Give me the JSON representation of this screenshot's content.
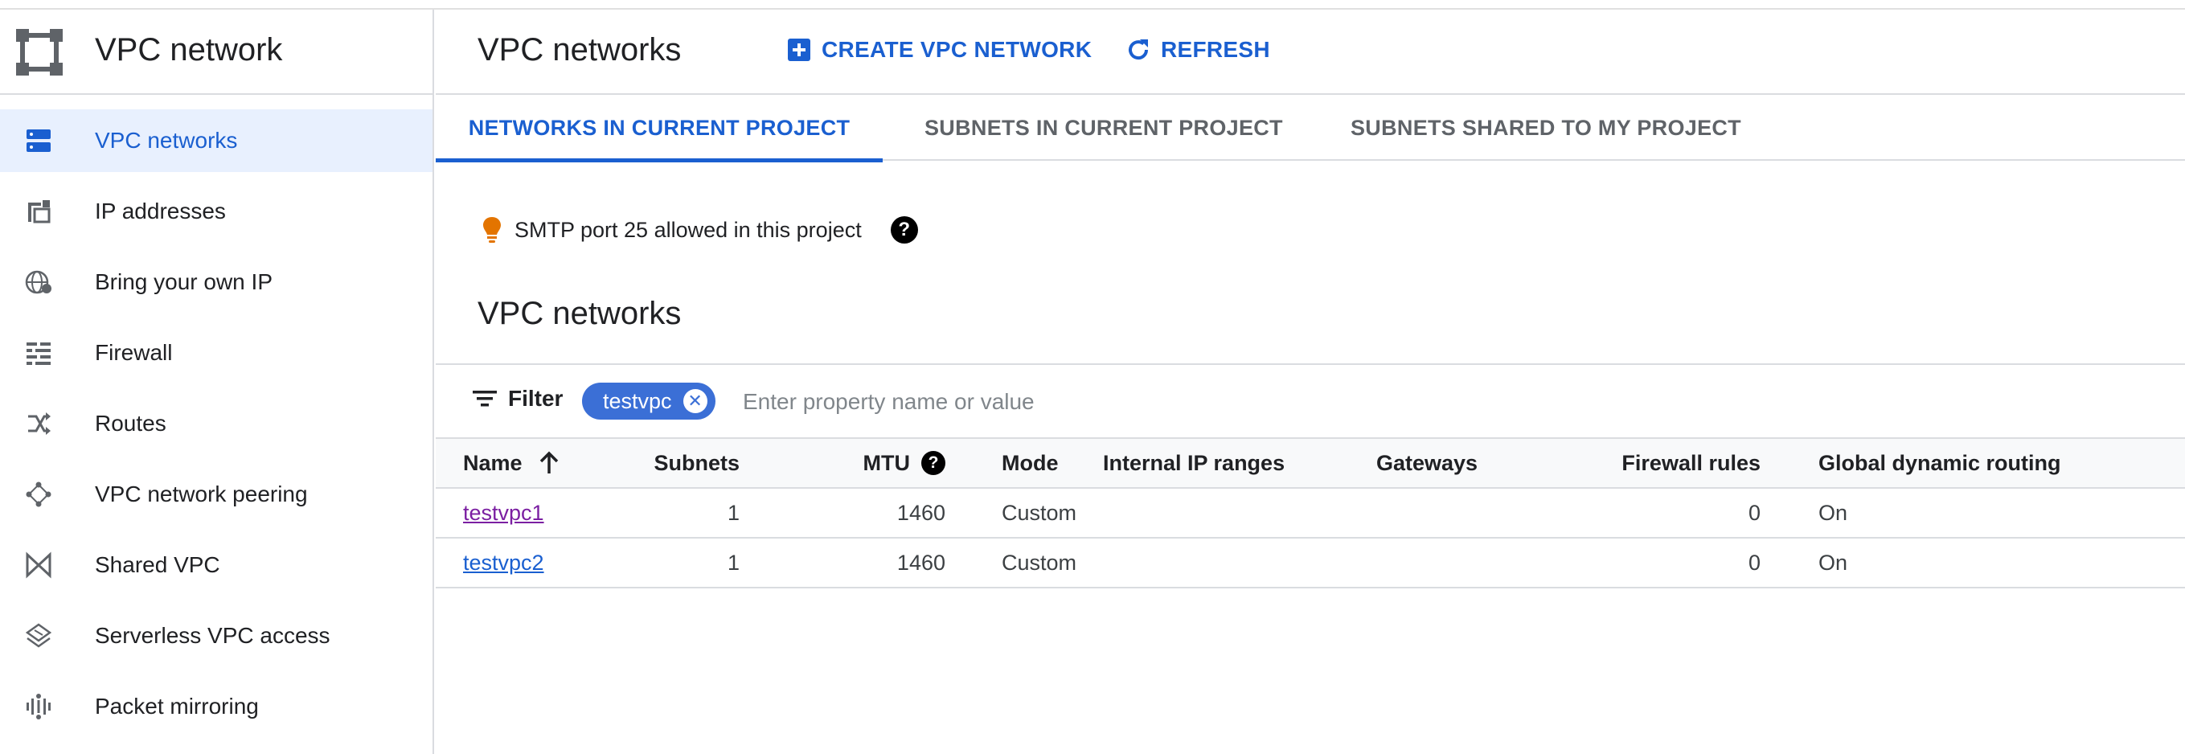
{
  "sidebar": {
    "title": "VPC network",
    "logo_icon": "vpc-network-logo",
    "items": [
      {
        "label": "VPC networks",
        "icon": "vpc-networks-icon",
        "active": true
      },
      {
        "label": "IP addresses",
        "icon": "ip-addresses-icon"
      },
      {
        "label": "Bring your own IP",
        "icon": "globe-icon"
      },
      {
        "label": "Firewall",
        "icon": "firewall-icon"
      },
      {
        "label": "Routes",
        "icon": "routes-icon"
      },
      {
        "label": "VPC network peering",
        "icon": "peering-icon"
      },
      {
        "label": "Shared VPC",
        "icon": "shared-vpc-icon"
      },
      {
        "label": "Serverless VPC access",
        "icon": "serverless-icon"
      },
      {
        "label": "Packet mirroring",
        "icon": "packet-mirroring-icon"
      }
    ]
  },
  "header": {
    "title": "VPC networks",
    "create_label": "CREATE VPC NETWORK",
    "refresh_label": "REFRESH"
  },
  "tabs": [
    {
      "label": "NETWORKS IN CURRENT PROJECT",
      "active": true
    },
    {
      "label": "SUBNETS IN CURRENT PROJECT"
    },
    {
      "label": "SUBNETS SHARED TO MY PROJECT"
    }
  ],
  "notice": {
    "text": "SMTP port 25 allowed in this project",
    "help": "?"
  },
  "section_title": "VPC networks",
  "filter": {
    "label": "Filter",
    "chip": "testvpc",
    "placeholder": "Enter property name or value"
  },
  "table": {
    "columns": {
      "name": "Name",
      "subnets": "Subnets",
      "mtu": "MTU",
      "mode": "Mode",
      "internal_ip": "Internal IP ranges",
      "gateways": "Gateways",
      "firewall": "Firewall rules",
      "routing": "Global dynamic routing"
    },
    "rows": [
      {
        "name": "testvpc1",
        "subnets": "1",
        "mtu": "1460",
        "mode": "Custom",
        "internal_ip": "",
        "gateways": "",
        "firewall": "0",
        "routing": "On"
      },
      {
        "name": "testvpc2",
        "subnets": "1",
        "mtu": "1460",
        "mode": "Custom",
        "internal_ip": "",
        "gateways": "",
        "firewall": "0",
        "routing": "On"
      }
    ]
  },
  "colors": {
    "accent": "#1a5fd0",
    "active_bg": "#e8f0fe",
    "chip": "#3b6fd6",
    "visited": "#7b1fa2",
    "bulb": "#e37400"
  }
}
